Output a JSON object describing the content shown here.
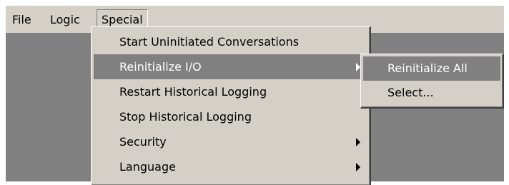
{
  "menubar": {
    "file": "File",
    "logic": "Logic",
    "special": "Special"
  },
  "special_menu": {
    "items": [
      {
        "label": "Start Uninitiated Conversations",
        "submenu": false
      },
      {
        "label": "Reinitialize I/O",
        "submenu": true,
        "selected": true
      },
      {
        "label": "Restart Historical Logging",
        "submenu": false
      },
      {
        "label": "Stop Historical Logging",
        "submenu": false
      },
      {
        "label": "Security",
        "submenu": true
      },
      {
        "label": "Language",
        "submenu": true
      }
    ]
  },
  "reinitialize_submenu": {
    "items": [
      {
        "label": "Reinitialize All",
        "selected": true
      },
      {
        "label": "Select..."
      }
    ]
  },
  "colors": {
    "menu_face": "#d4d0c8",
    "highlight": "#808080",
    "workspace": "#808080",
    "highlight_text": "#ffffff"
  },
  "icons": {
    "submenu_arrow": "chevron-right-icon"
  }
}
